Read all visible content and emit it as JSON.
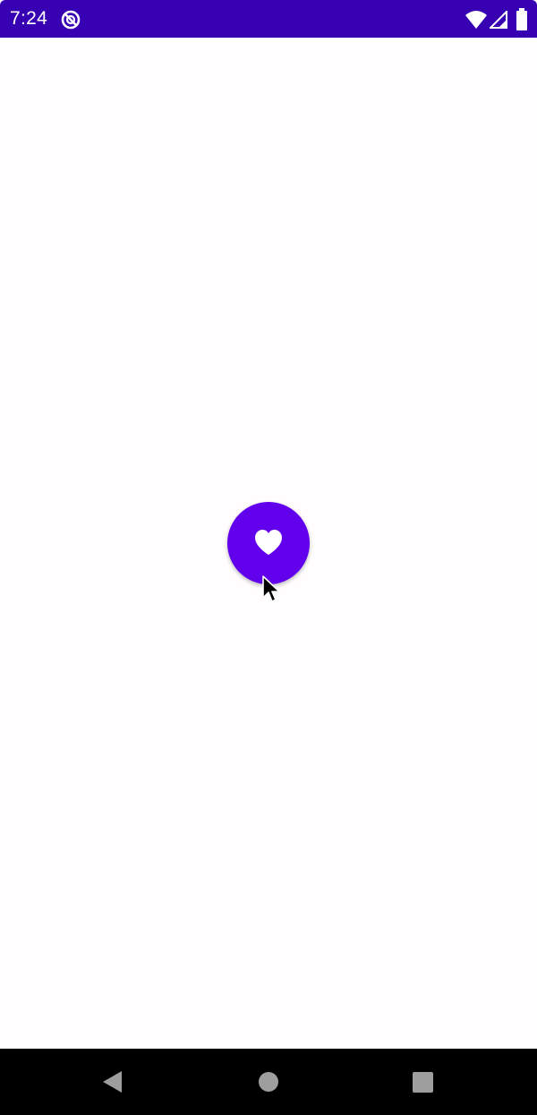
{
  "status_bar": {
    "time": "7:24",
    "background_color": "#3700b3",
    "icons": [
      "sync-icon",
      "wifi-icon",
      "cellular-signal-icon",
      "battery-icon"
    ]
  },
  "main": {
    "background_color": "#fffdfe",
    "fab": {
      "icon": "heart-icon",
      "color": "#6200ee"
    }
  },
  "nav_bar": {
    "buttons": [
      "back",
      "home",
      "recents"
    ],
    "icon_color": "#9e9e9e"
  }
}
